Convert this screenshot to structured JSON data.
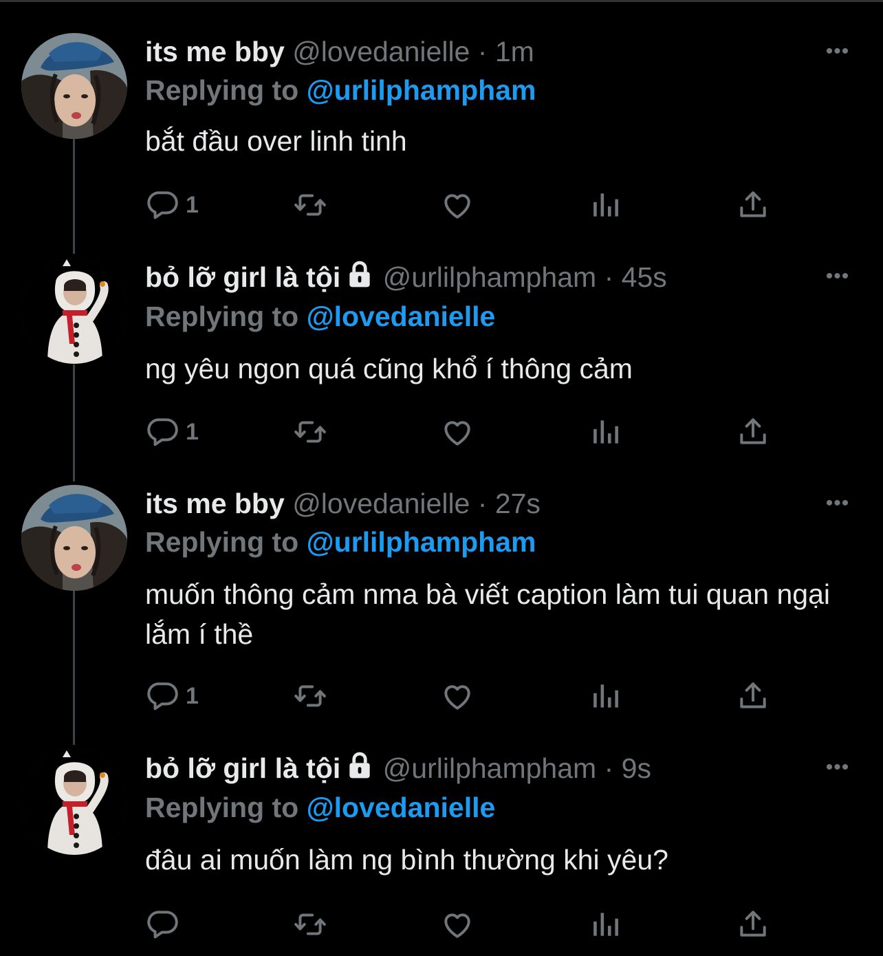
{
  "colors": {
    "background": "#000000",
    "text": "#e7e9ea",
    "muted": "#71767b",
    "accent": "#1d9bf0"
  },
  "tweets": [
    {
      "name": "its me bby",
      "protected": false,
      "handle": "@lovedanielle",
      "time": "1m",
      "replying_label": "Replying to",
      "replying_to": "@urlilphampham",
      "text": "bắt đầu over linh tinh",
      "reply_count": "1",
      "avatar": "avatar-blue-hat"
    },
    {
      "name": "bỏ lỡ girl là tội",
      "protected": true,
      "handle": "@urlilphampham",
      "time": "45s",
      "replying_label": "Replying to",
      "replying_to": "@lovedanielle",
      "text": "ng yêu ngon quá cũng khổ í thông cảm",
      "reply_count": "1",
      "avatar": "avatar-snowman-costume"
    },
    {
      "name": "its me bby",
      "protected": false,
      "handle": "@lovedanielle",
      "time": "27s",
      "replying_label": "Replying to",
      "replying_to": "@urlilphampham",
      "text": "muốn thông cảm nma bà viết caption làm tui quan ngại lắm í thề",
      "reply_count": "1",
      "avatar": "avatar-blue-hat"
    },
    {
      "name": "bỏ lỡ girl là tội",
      "protected": true,
      "handle": "@urlilphampham",
      "time": "9s",
      "replying_label": "Replying to",
      "replying_to": "@lovedanielle",
      "text": "đâu ai muốn làm ng bình thường khi yêu?",
      "reply_count": "",
      "avatar": "avatar-snowman-costume"
    }
  ],
  "icons": {
    "reply": "reply-icon",
    "retweet": "retweet-icon",
    "like": "heart-icon",
    "analytics": "analytics-icon",
    "share": "share-icon",
    "more": "more-icon",
    "lock": "lock-icon"
  }
}
